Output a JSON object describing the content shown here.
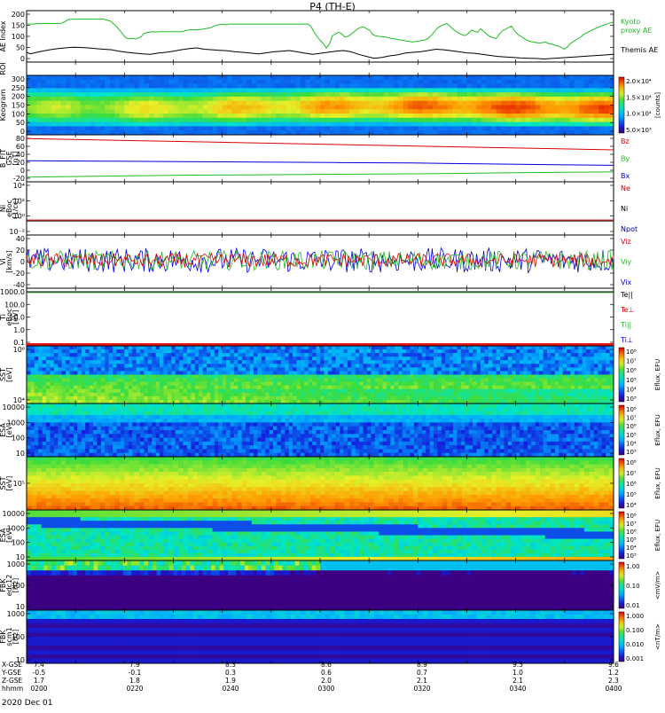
{
  "title": "P4 (TH-E)",
  "date_label": "2020 Dec 01",
  "colors": {
    "green": "#22bb22",
    "black": "#000000",
    "red": "#dd0000",
    "blue": "#0000dd",
    "ne": "#cc0000",
    "ni": "#000000",
    "npot": "#000099"
  },
  "chart_data": [
    {
      "id": "ae",
      "type": "line",
      "ylabel": "AE Index",
      "yticks": [
        "200",
        "150",
        "100",
        "50",
        "0"
      ],
      "ylim": [
        0,
        200
      ],
      "series": [
        {
          "name": "Kyoto proxy AE",
          "color": "green",
          "x": [
            0,
            6,
            8,
            12,
            20,
            28,
            31,
            37,
            45,
            50,
            54,
            62,
            70,
            80,
            92,
            100,
            108,
            116,
            122,
            128,
            132,
            136,
            142,
            148,
            152,
            158,
            163,
            168,
            173,
            178,
            183,
            188,
            194,
            200,
            206,
            212,
            218,
            225,
            232,
            238,
            243,
            248,
            254,
            258,
            263,
            268,
            274,
            280,
            286,
            292,
            298,
            304,
            310,
            316,
            322,
            328,
            333,
            338,
            343,
            348,
            352,
            356,
            360,
            364,
            368,
            372,
            376,
            380,
            384,
            388,
            392,
            396,
            400,
            404,
            408,
            412,
            416,
            420,
            424,
            428,
            432,
            436,
            440,
            444,
            448,
            452,
            456,
            460,
            464,
            468,
            472,
            476,
            480,
            484,
            488,
            492,
            496,
            500,
            504,
            508,
            512,
            516,
            520,
            524,
            528,
            532,
            536,
            540,
            544,
            548,
            552,
            556,
            560,
            564,
            568,
            572,
            576,
            580,
            584,
            588,
            592,
            596,
            600,
            604,
            608,
            612,
            616,
            620,
            624,
            628,
            632,
            636,
            640,
            644,
            648,
            652,
            656,
            660,
            664,
            668,
            672,
            676,
            680,
            684,
            688,
            692,
            696,
            700,
            704,
            708,
            712,
            716,
            720,
            724,
            728,
            732,
            736,
            740,
            744,
            748,
            752,
            756,
            760
          ],
          "y": [
            148,
            148,
            148,
            149,
            150,
            151,
            150,
            150,
            151,
            158,
            166,
            167,
            167,
            167,
            167,
            167,
            160,
            140,
            118,
            95,
            90,
            92,
            90,
            98,
            112,
            116,
            118,
            117,
            118,
            118,
            118,
            118,
            118,
            118,
            122,
            127,
            125,
            127,
            130,
            133,
            140,
            145,
            147,
            145,
            148,
            148,
            148,
            148,
            148,
            148,
            148,
            148,
            148,
            148,
            148,
            148,
            148,
            148,
            148,
            148,
            148,
            148,
            148,
            148,
            140,
            118,
            100,
            85,
            72,
            55,
            70,
            102,
            110,
            116,
            110,
            98,
            100,
            108,
            118,
            128,
            134,
            137,
            130,
            124,
            108,
            102,
            100,
            99,
            98,
            95,
            92,
            90,
            88,
            86,
            84,
            82,
            80,
            78,
            80,
            82,
            84,
            86,
            92,
            104,
            118,
            132,
            140,
            146,
            150,
            140,
            128,
            120,
            112,
            106,
            103,
            112,
            124,
            120,
            116,
            130,
            118,
            108,
            100,
            95,
            92,
            108,
            122,
            128,
            134,
            140,
            120,
            108,
            100,
            92,
            85,
            80,
            78,
            76,
            74,
            76,
            78,
            72,
            70,
            66,
            62,
            58,
            50,
            58,
            72,
            80,
            88,
            95,
            104,
            112,
            118,
            125,
            130,
            135,
            140,
            145,
            149,
            152,
            155
          ]
        },
        {
          "name": "Themis AE",
          "color": "black",
          "x": [
            0,
            5,
            10,
            20,
            30,
            40,
            50,
            60,
            70,
            80,
            90,
            100,
            110,
            120,
            130,
            140,
            150,
            160,
            170,
            180,
            190,
            200,
            210,
            220,
            230,
            240,
            250,
            260,
            270,
            280,
            290,
            300,
            310,
            320,
            330,
            340,
            350,
            360,
            370,
            380,
            390,
            400,
            410,
            420,
            430,
            440,
            450,
            460,
            470,
            480,
            490,
            500,
            510,
            520,
            530,
            540,
            550,
            560,
            570,
            580,
            590,
            600,
            610,
            620,
            630,
            640,
            650,
            660,
            670,
            680,
            690,
            700,
            710,
            720,
            730,
            740,
            750,
            760
          ],
          "y": [
            38,
            32,
            36,
            42,
            48,
            52,
            55,
            58,
            57,
            55,
            52,
            50,
            48,
            42,
            38,
            35,
            32,
            30,
            35,
            38,
            42,
            48,
            52,
            55,
            50,
            48,
            46,
            44,
            40,
            38,
            35,
            32,
            36,
            40,
            42,
            45,
            40,
            35,
            30,
            34,
            38,
            42,
            45,
            40,
            30,
            22,
            15,
            18,
            24,
            28,
            35,
            38,
            40,
            45,
            50,
            48,
            44,
            40,
            36,
            34,
            30,
            26,
            22,
            20,
            18,
            16,
            15,
            14,
            12,
            14,
            16,
            18,
            20,
            22,
            24,
            26,
            28,
            30
          ]
        }
      ],
      "legend": [
        "Kyoto proxy AE",
        "Themis AE"
      ]
    },
    {
      "id": "roi",
      "type": "line",
      "ylabel": "ROI"
    },
    {
      "id": "keogram",
      "type": "heatmap",
      "ylabel": "Keogram",
      "yticks": [
        "300",
        "250",
        "200",
        "150",
        "100",
        "50",
        "0"
      ],
      "ylim": [
        0,
        300
      ],
      "colorbar": {
        "ticks": [
          "2.0×10⁴",
          "1.5×10⁴",
          "1.0×10⁴",
          "5.0×10³"
        ],
        "label": "[counts]"
      }
    },
    {
      "id": "bfit",
      "type": "line",
      "ylabel": "B_FIT",
      "sublabel": "GSE",
      "unit": "[nT]",
      "yticks": [
        "80",
        "60",
        "40",
        "20",
        "0",
        "-20"
      ],
      "ylim": [
        -20,
        80
      ],
      "series": [
        {
          "name": "Bz",
          "color": "red",
          "x": [
            0,
            760
          ],
          "y": [
            72,
            48
          ]
        },
        {
          "name": "By",
          "color": "green",
          "x": [
            0,
            100,
            200,
            300,
            400,
            500,
            560,
            620,
            680,
            760
          ],
          "y": [
            -10,
            -8,
            -6,
            -5,
            -4,
            -3,
            -2,
            -1,
            0,
            1
          ]
        },
        {
          "name": "Bx",
          "color": "blue",
          "x": [
            0,
            100,
            200,
            300,
            400,
            500,
            600,
            650,
            700,
            760
          ],
          "y": [
            25,
            24,
            23,
            22,
            21,
            20,
            18,
            17,
            16,
            15
          ]
        }
      ],
      "legend": [
        "Bz",
        "By",
        "Bx"
      ]
    },
    {
      "id": "ni",
      "type": "line",
      "ylabel": "Ni",
      "sublabel": "eBoc",
      "unit": "[1/cc]",
      "yticks": [
        "10⁴",
        "10²",
        "10⁰",
        "10⁻²"
      ],
      "series": [
        {
          "name": "Ne",
          "color": "ne",
          "x": [
            0,
            760
          ],
          "y": [
            0.3,
            0.3
          ]
        },
        {
          "name": "Ni",
          "color": "ni",
          "x": [
            0,
            760
          ],
          "y": [
            0.3,
            0.3
          ]
        },
        {
          "name": "Npot",
          "color": "npot",
          "x": [
            0,
            760
          ],
          "y": [
            0.3,
            0.3
          ]
        }
      ],
      "legend": [
        "Ne",
        "Ni",
        "Npot"
      ]
    },
    {
      "id": "vi",
      "type": "line",
      "ylabel": "Vi",
      "unit": "[km/s]",
      "yticks": [
        "40",
        "20",
        "0",
        "-20",
        "-40"
      ],
      "ylim": [
        -55,
        50
      ],
      "series": [
        {
          "name": "Viz",
          "color": "red"
        },
        {
          "name": "Viy",
          "color": "green"
        },
        {
          "name": "Vix",
          "color": "blue"
        }
      ],
      "legend": [
        "Viz",
        "Viy",
        "Vix"
      ]
    },
    {
      "id": "ti",
      "type": "line",
      "ylabel": "Ti",
      "sublabel": "eBoc",
      "unit": "[eV]",
      "yticks": [
        "1000.0",
        "100.0",
        "10.0",
        "1.0",
        "0.1"
      ],
      "series": [
        {
          "name": "Te||",
          "color": "black",
          "x": [
            0,
            760
          ],
          "y": [
            1300,
            1300
          ]
        },
        {
          "name": "Te⊥",
          "color": "red"
        },
        {
          "name": "Ti||",
          "color": "green"
        },
        {
          "name": "Ti⊥",
          "color": "blue"
        }
      ],
      "legend": [
        "Te||",
        "Te⊥",
        "Ti||",
        "Ti⊥"
      ]
    },
    {
      "id": "sst1",
      "type": "heatmap",
      "ylabel": "SST",
      "unit": "[eV]",
      "yticks": [
        "10⁶",
        "10⁴"
      ],
      "colorbar": {
        "ticks": [
          "10⁸",
          "10⁷",
          "10⁶",
          "10⁵",
          "10⁴",
          "10³"
        ],
        "label": "Eflux, EFU"
      }
    },
    {
      "id": "esa1",
      "type": "heatmap",
      "ylabel": "ESA",
      "unit": "[eV]",
      "yticks": [
        "10000",
        "1000",
        "100",
        "10"
      ],
      "colorbar": {
        "ticks": [
          "10⁸",
          "10⁷",
          "10⁶",
          "10⁵",
          "10⁴",
          "10³"
        ],
        "label": "Eflux, EFU"
      }
    },
    {
      "id": "sst2",
      "type": "heatmap",
      "ylabel": "SST",
      "unit": "[eV]",
      "yticks": [
        "10⁵"
      ],
      "colorbar": {
        "ticks": [
          "10⁸",
          "10⁷",
          "10⁶",
          "10⁵",
          "10⁴"
        ],
        "label": "Eflux, EFU"
      }
    },
    {
      "id": "esa2",
      "type": "heatmap",
      "ylabel": "ESA",
      "unit": "[eV]",
      "yticks": [
        "10000",
        "1000",
        "100",
        "10"
      ],
      "colorbar": {
        "ticks": [
          "10⁸",
          "10⁷",
          "10⁶",
          "10⁵",
          "10⁴",
          "10³"
        ],
        "label": "Eflux, EFU"
      }
    },
    {
      "id": "fbk1",
      "type": "heatmap",
      "ylabel": "FBK",
      "sublabel": "edc12",
      "unit": "[Hz]",
      "yticks": [
        "1000",
        "100",
        "10"
      ],
      "colorbar": {
        "ticks": [
          "1.00",
          "0.10",
          "0.01"
        ],
        "label": "<mV/m>"
      }
    },
    {
      "id": "fbk2",
      "type": "heatmap",
      "ylabel": "FBK",
      "sublabel": "scm1",
      "unit": "[Hz]",
      "yticks": [
        "1000",
        "100",
        "10"
      ],
      "colorbar": {
        "ticks": [
          "1.000",
          "0.100",
          "0.010",
          "0.001"
        ],
        "label": "<nT/m>"
      }
    }
  ],
  "time_axis": {
    "row_labels": [
      "X-GSE",
      "Y-GSE",
      "Z-GSE",
      "hhmm"
    ],
    "columns": [
      {
        "x": "7.4",
        "y": "-0.5",
        "z": "1.7",
        "t": "0200"
      },
      {
        "x": "7.9",
        "y": "-0.1",
        "z": "1.8",
        "t": "0220"
      },
      {
        "x": "8.3",
        "y": "0.3",
        "z": "1.9",
        "t": "0240"
      },
      {
        "x": "8.6",
        "y": "0.6",
        "z": "2.0",
        "t": "0300"
      },
      {
        "x": "8.9",
        "y": "0.7",
        "z": "2.1",
        "t": "0320"
      },
      {
        "x": "9.3",
        "y": "1.0",
        "z": "2.1",
        "t": "0340"
      },
      {
        "x": "9.6",
        "y": "1.2",
        "z": "2.3",
        "t": "0400"
      }
    ]
  }
}
